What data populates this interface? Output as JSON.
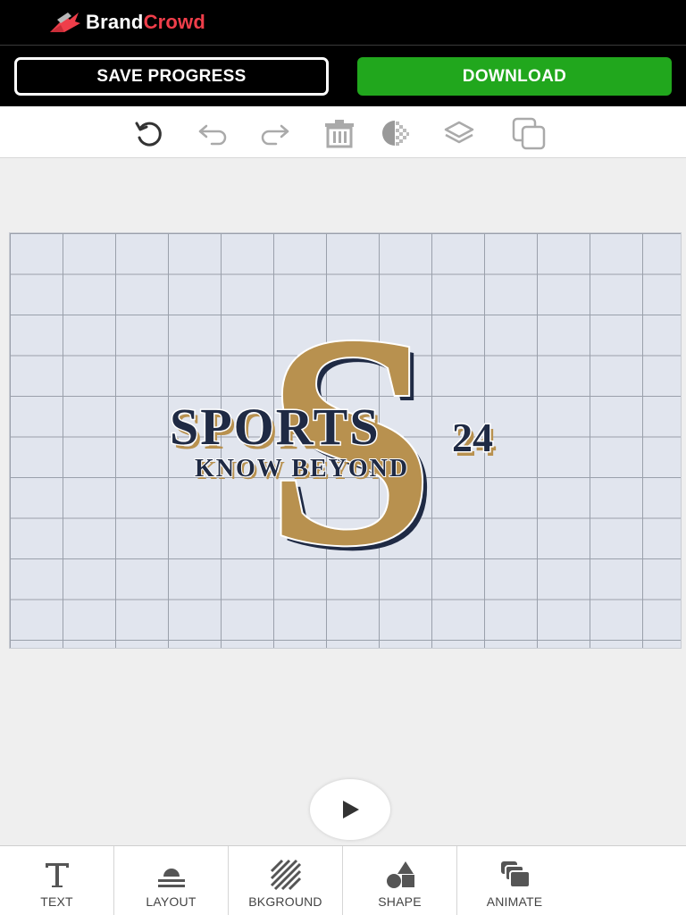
{
  "brand": {
    "name_part1": "Brand",
    "name_part2": "Crowd"
  },
  "actions": {
    "save_label": "SAVE PROGRESS",
    "download_label": "DOWNLOAD"
  },
  "toolbar": {
    "tools": [
      "reset-icon",
      "undo-icon",
      "redo-icon",
      "trash-icon",
      "transparency-icon",
      "layers-icon",
      "duplicate-icon"
    ]
  },
  "design": {
    "headline": "SPORTS",
    "number": "24",
    "tagline": "KNOW BEYOND",
    "monogram": "S",
    "colors": {
      "gold": "#b8914f",
      "navy": "#1f2a44"
    }
  },
  "colors": {
    "brand_accent": "#ef3e4a",
    "download": "#21a71d"
  },
  "bottom_tabs": [
    {
      "label": "TEXT",
      "icon": "text-icon"
    },
    {
      "label": "LAYOUT",
      "icon": "layout-icon"
    },
    {
      "label": "BKGROUND",
      "icon": "background-icon"
    },
    {
      "label": "SHAPE",
      "icon": "shape-icon"
    },
    {
      "label": "ANIMATE",
      "icon": "animate-icon"
    }
  ]
}
